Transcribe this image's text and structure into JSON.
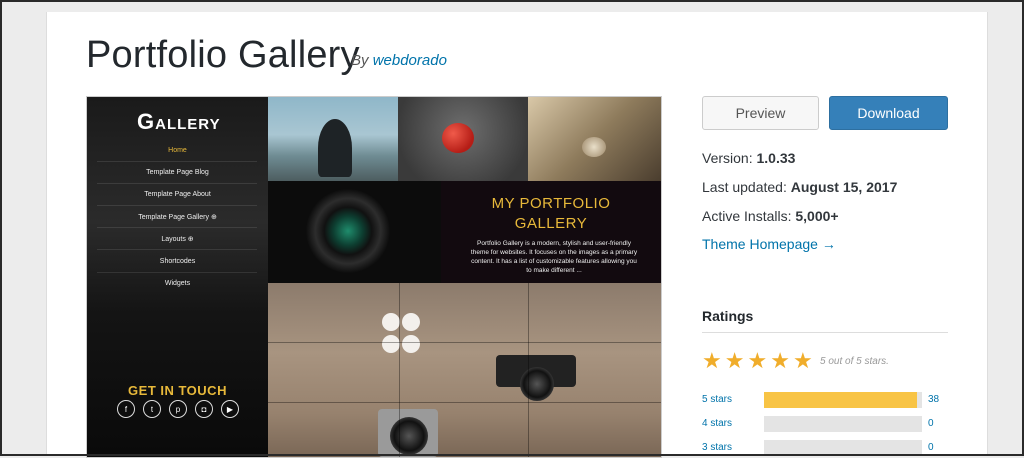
{
  "page": {
    "title": "Portfolio Gallery",
    "by_prefix": "By",
    "author": "webdorado"
  },
  "screenshot": {
    "logo_letter": "G",
    "logo_text": "ALLERY",
    "menu": [
      {
        "label": "Home",
        "active": true
      },
      {
        "label": "Template Page Blog"
      },
      {
        "label": "Template Page About"
      },
      {
        "label": "Template Page Gallery ⊕"
      },
      {
        "label": "Layouts ⊕"
      },
      {
        "label": "Shortcodes"
      },
      {
        "label": "Widgets"
      }
    ],
    "get_in_touch": "GET IN TOUCH",
    "social_icons": [
      "facebook-icon",
      "twitter-icon",
      "pinterest-icon",
      "instagram-icon",
      "youtube-icon"
    ],
    "portfolio_title_1": "MY PORTFOLIO",
    "portfolio_title_2": "GALLERY",
    "portfolio_desc": "Portfolio Gallery is a modern, stylish and user-friendly theme for websites. It focuses on the images as a primary content. It has a list of customizable features allowing you to make different ...",
    "accent_color": "#e8b93a"
  },
  "actions": {
    "preview_label": "Preview",
    "download_label": "Download",
    "download_color": "#3580b9"
  },
  "meta": {
    "version_label": "Version:",
    "version_value": "1.0.33",
    "updated_label": "Last updated:",
    "updated_value": "August 15, 2017",
    "installs_label": "Active Installs:",
    "installs_value": "5,000+",
    "homepage_link": "Theme Homepage →"
  },
  "ratings": {
    "heading": "Ratings",
    "stars": 5,
    "stars_caption": "5 out of 5 stars.",
    "star_color": "#f0ad2b",
    "rows": [
      {
        "label": "5 stars",
        "count": "38",
        "fraction": 0.97
      },
      {
        "label": "4 stars",
        "count": "0",
        "fraction": 0
      },
      {
        "label": "3 stars",
        "count": "0",
        "fraction": 0
      }
    ]
  }
}
